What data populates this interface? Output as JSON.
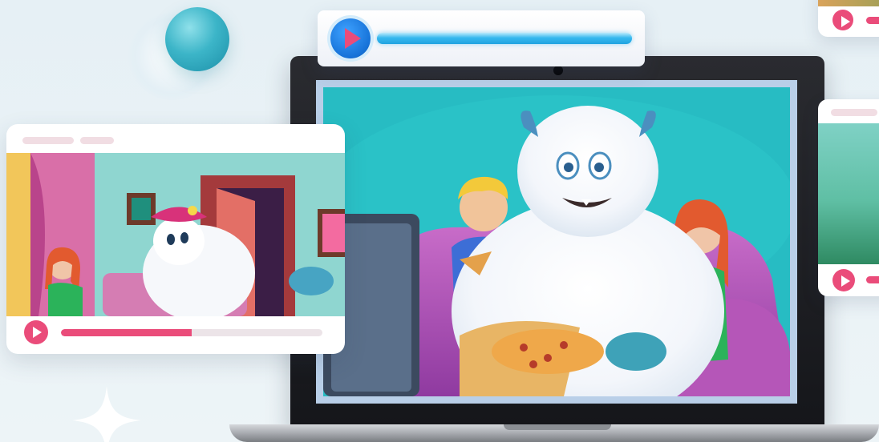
{
  "colors": {
    "accent": "#ea4c7a",
    "play_blue": "#1672d8",
    "track_blue": "#2fb2ea",
    "background": "#e8f1f6",
    "laptop_bezel": "#1d1e22",
    "orb": "#3cb5c8"
  },
  "icons": {
    "float_play": "play-icon",
    "card_play": "play-icon",
    "sparkle": "sparkle-icon",
    "orb": "orb-decoration"
  },
  "players": {
    "floating": {
      "progress": 1.0
    },
    "left_card": {
      "progress": 0.5
    },
    "right_top_card": {
      "progress": 0.2
    },
    "right_mid_card": {
      "progress": 0.2
    }
  },
  "scenes": {
    "main": "laptop-video-frame",
    "left": "video-thumbnail-left",
    "right_top": "video-thumbnail-right-top",
    "right_mid": "video-thumbnail-right-mid"
  }
}
